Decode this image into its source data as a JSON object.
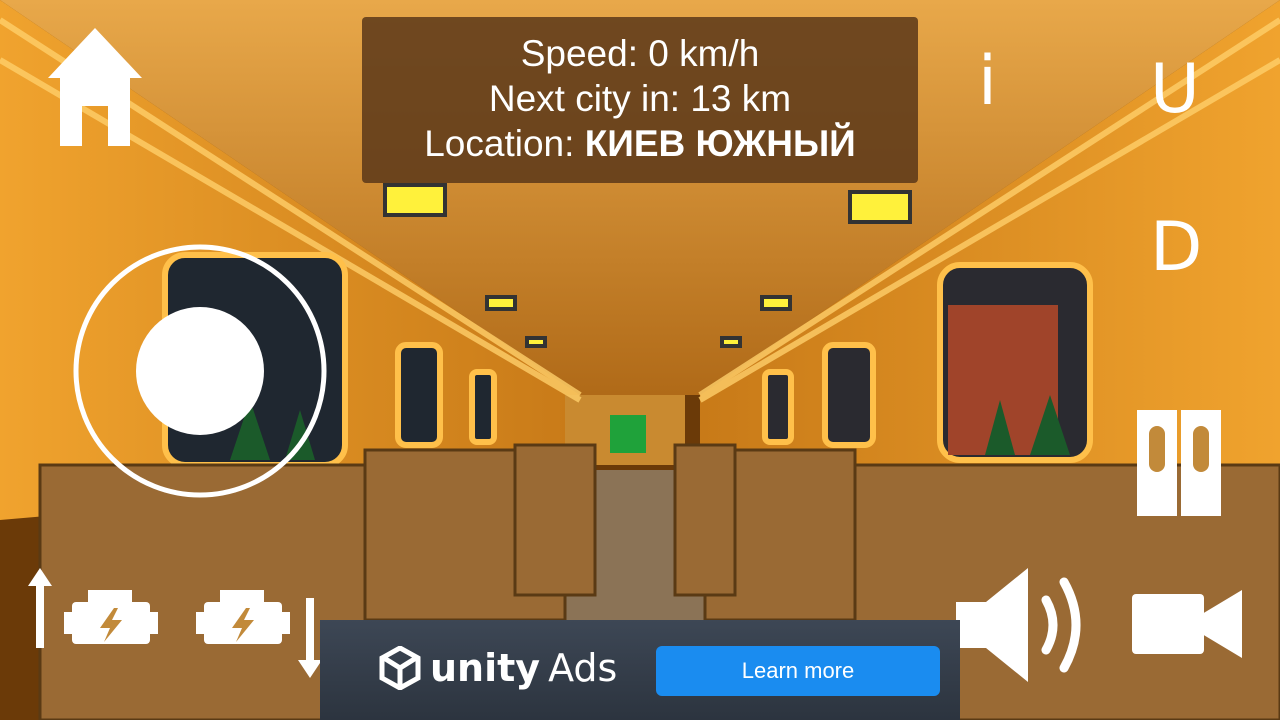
{
  "hud": {
    "speed_line": "Speed: 0 km/h",
    "next_city_line": "Next city in: 13 km",
    "location_label": "Location: ",
    "location_value": "КИЕВ ЮЖНЫЙ"
  },
  "buttons": {
    "info": "i",
    "up": "U",
    "down": "D"
  },
  "ad": {
    "brand_unity": "unity",
    "brand_ads": "Ads",
    "cta": "Learn more"
  },
  "icons": [
    "home-icon",
    "info-icon",
    "up-icon",
    "down-icon",
    "doors-icon",
    "joystick-icon",
    "engine-up-icon",
    "engine-down-icon",
    "speaker-icon",
    "camera-icon",
    "unity-logo-icon"
  ],
  "colors": {
    "hud_bg": "#5a3719",
    "wall": "#e09a2c",
    "ad_cta": "#1a8cf0"
  }
}
